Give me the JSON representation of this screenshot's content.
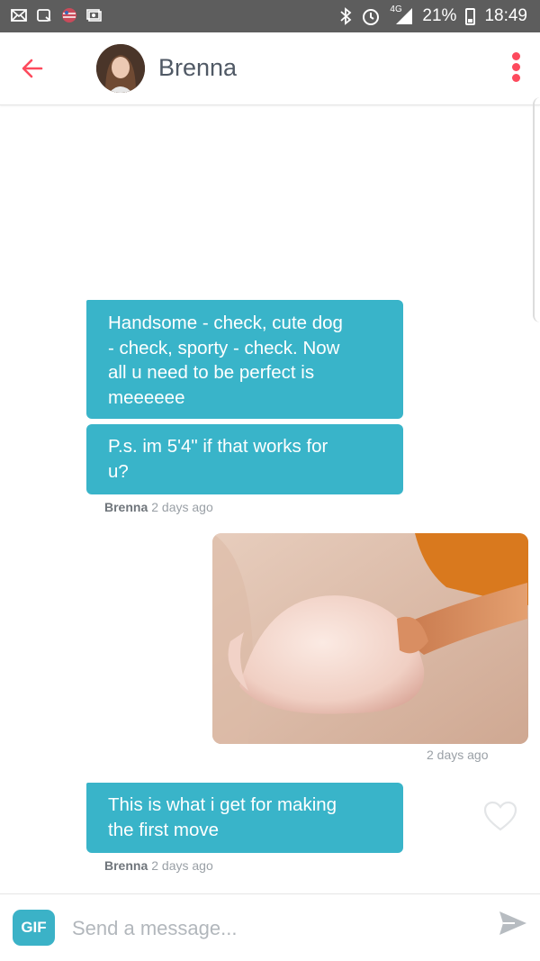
{
  "status_bar": {
    "signal": "4G",
    "battery": "21%",
    "time": "18:49",
    "icons": [
      "mail-icon",
      "screenshot-icon",
      "globe-icon",
      "gallery-icon",
      "bluetooth-icon",
      "alarm-icon",
      "signal-icon",
      "battery-icon"
    ]
  },
  "header": {
    "contact_name": "Brenna",
    "icons": [
      "back-arrow-icon",
      "avatar",
      "kebab-menu-icon"
    ],
    "accent": "#fd4a5d"
  },
  "messages": [
    {
      "from": "Brenna",
      "lines": [
        "Handsome - check, cute dog",
        "- check, sporty - check. Now",
        "all u need to be perfect is",
        "meeeeee"
      ]
    },
    {
      "from": "Brenna",
      "lines": [
        "P.s. im 5'4\" if that works for",
        "u?"
      ],
      "meta_name": "Brenna",
      "meta_time": "2 days ago"
    },
    {
      "from": "me",
      "type": "photo",
      "meta_time": "2 days ago"
    },
    {
      "from": "Brenna",
      "lines": [
        "This is what i get for making",
        "the first move"
      ],
      "meta_name": "Brenna",
      "meta_time": "2 days ago"
    }
  ],
  "composer": {
    "gif_label": "GIF",
    "placeholder": "Send a message...",
    "send_icon": "send-icon"
  },
  "colors": {
    "bubble": "#39b4c9",
    "accent": "#fd4a5d",
    "status_bar": "#5d5d5d"
  }
}
